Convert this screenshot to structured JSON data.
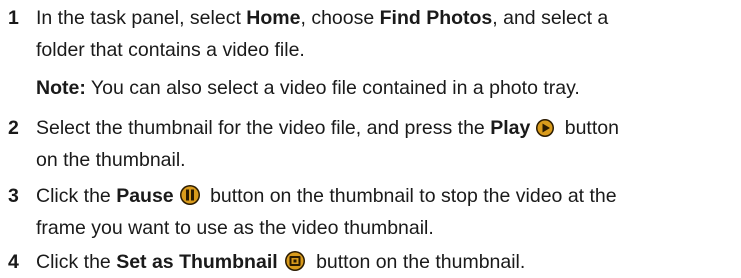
{
  "steps": [
    {
      "number": "1",
      "line1_a": "In the task panel, select ",
      "line1_b": "Home",
      "line1_c": ", choose ",
      "line1_d": "Find Photos",
      "line1_e": ", and select a",
      "line2": "folder that contains a video file.",
      "note_label": "Note:",
      "note_text": " You can also select a video file contained in a photo tray."
    },
    {
      "number": "2",
      "line1_a": "Select the thumbnail for the video file, and press the ",
      "line1_b": "Play",
      "line1_c": " button",
      "line2": "on the thumbnail.",
      "icon": "play-icon"
    },
    {
      "number": "3",
      "line1_a": "Click the ",
      "line1_b": "Pause",
      "line1_c": " button on the thumbnail to stop the video at the",
      "line2": "frame you want to use as the video thumbnail.",
      "icon": "pause-icon"
    },
    {
      "number": "4",
      "line1_a": "Click the ",
      "line1_b": "Set as Thumbnail",
      "line1_c": " button on the thumbnail.",
      "icon": "set-thumbnail-icon"
    }
  ],
  "colors": {
    "text": "#1a1a1a",
    "icon_dark": "#2a1a00",
    "icon_gold": "#d99b1c"
  }
}
